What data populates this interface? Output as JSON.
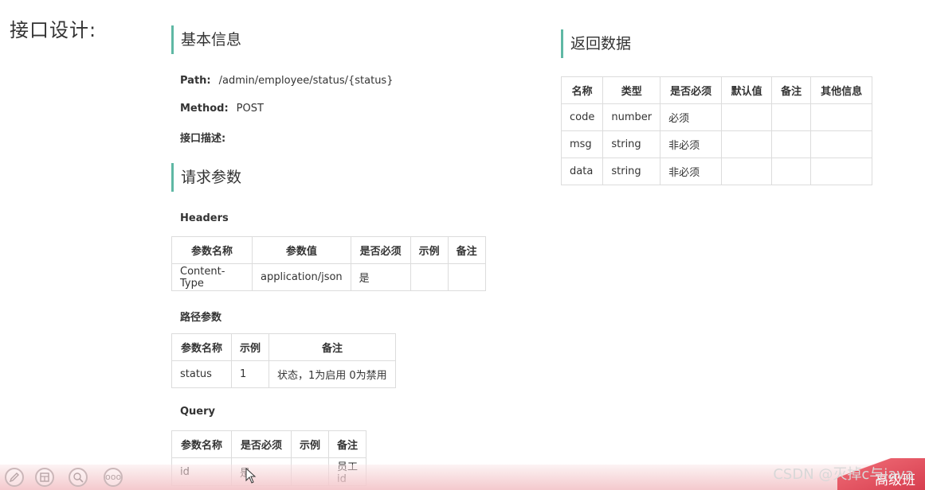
{
  "page": {
    "title": "接口设计:"
  },
  "basic_info": {
    "heading": "基本信息",
    "path_label": "Path:",
    "path_value": "/admin/employee/status/{status}",
    "method_label": "Method:",
    "method_value": "POST",
    "desc_label": "接口描述:"
  },
  "request_params": {
    "heading": "请求参数",
    "headers": {
      "label": "Headers",
      "columns": [
        "参数名称",
        "参数值",
        "是否必须",
        "示例",
        "备注"
      ],
      "rows": [
        [
          "Content-Type",
          "application/json",
          "是",
          "",
          ""
        ]
      ]
    },
    "path_params": {
      "label": "路径参数",
      "columns": [
        "参数名称",
        "示例",
        "备注"
      ],
      "rows": [
        [
          "status",
          "1",
          "状态，1为启用 0为禁用"
        ]
      ]
    },
    "query": {
      "label": "Query",
      "columns": [
        "参数名称",
        "是否必须",
        "示例",
        "备注"
      ],
      "rows": [
        [
          "id",
          "是",
          "",
          "员工id"
        ]
      ]
    }
  },
  "response": {
    "heading": "返回数据",
    "columns": [
      "名称",
      "类型",
      "是否必须",
      "默认值",
      "备注",
      "其他信息"
    ],
    "rows": [
      [
        "code",
        "number",
        "必须",
        "",
        "",
        ""
      ],
      [
        "msg",
        "string",
        "非必须",
        "",
        "",
        ""
      ],
      [
        "data",
        "string",
        "非必须",
        "",
        "",
        ""
      ]
    ]
  },
  "toolbar": {
    "icons": [
      "pen-icon",
      "layout-icon",
      "zoom-icon",
      "more-icon"
    ],
    "more_text": "ooo"
  },
  "overlay": {
    "watermark": "CSDN @灭掉c与java",
    "corner_text": "高级班"
  },
  "colors": {
    "accent": "#5fb8a4",
    "table_border": "#dcdcdc",
    "bottom_bar": "#f4c9cd",
    "corner_red": "#d73e4f"
  }
}
